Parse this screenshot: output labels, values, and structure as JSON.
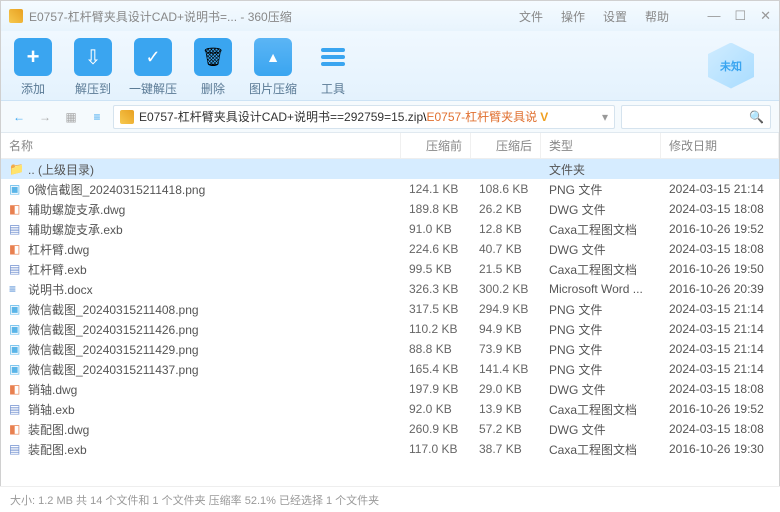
{
  "title": "E0757-杠杆臂夹具设计CAD+说明书=... - 360压缩",
  "menu": {
    "file": "文件",
    "op": "操作",
    "set": "设置",
    "help": "帮助"
  },
  "toolbar": {
    "add": "添加",
    "extract": "解压到",
    "oneclick": "一键解压",
    "delete": "删除",
    "imgcomp": "图片压缩",
    "tools": "工具",
    "badge": "未知"
  },
  "path": {
    "p1": "E0757-杠杆臂夹具设计CAD+说明书==292759=15.zip",
    "sep": "\\",
    "p2": "E0757-杠杆臂夹具说"
  },
  "cols": {
    "name": "名称",
    "before": "压缩前",
    "after": "压缩后",
    "type": "类型",
    "date": "修改日期"
  },
  "up": ".. (上级目录)",
  "uptype": "文件夹",
  "files": [
    {
      "ico": "fi-img",
      "name": "0微信截图_20240315211418.png",
      "bef": "124.1 KB",
      "aft": "108.6 KB",
      "type": "PNG 文件",
      "date": "2024-03-15 21:14"
    },
    {
      "ico": "fi-dwg",
      "name": "辅助螺旋支承.dwg",
      "bef": "189.8 KB",
      "aft": "26.2 KB",
      "type": "DWG 文件",
      "date": "2024-03-15 18:08"
    },
    {
      "ico": "fi-exb",
      "name": "辅助螺旋支承.exb",
      "bef": "91.0 KB",
      "aft": "12.8 KB",
      "type": "Caxa工程图文档",
      "date": "2016-10-26 19:52"
    },
    {
      "ico": "fi-dwg",
      "name": "杠杆臂.dwg",
      "bef": "224.6 KB",
      "aft": "40.7 KB",
      "type": "DWG 文件",
      "date": "2024-03-15 18:08"
    },
    {
      "ico": "fi-exb",
      "name": "杠杆臂.exb",
      "bef": "99.5 KB",
      "aft": "21.5 KB",
      "type": "Caxa工程图文档",
      "date": "2016-10-26 19:50"
    },
    {
      "ico": "fi-doc",
      "name": "说明书.docx",
      "bef": "326.3 KB",
      "aft": "300.2 KB",
      "type": "Microsoft Word ...",
      "date": "2016-10-26 20:39"
    },
    {
      "ico": "fi-img",
      "name": "微信截图_20240315211408.png",
      "bef": "317.5 KB",
      "aft": "294.9 KB",
      "type": "PNG 文件",
      "date": "2024-03-15 21:14"
    },
    {
      "ico": "fi-img",
      "name": "微信截图_20240315211426.png",
      "bef": "110.2 KB",
      "aft": "94.9 KB",
      "type": "PNG 文件",
      "date": "2024-03-15 21:14"
    },
    {
      "ico": "fi-img",
      "name": "微信截图_20240315211429.png",
      "bef": "88.8 KB",
      "aft": "73.9 KB",
      "type": "PNG 文件",
      "date": "2024-03-15 21:14"
    },
    {
      "ico": "fi-img",
      "name": "微信截图_20240315211437.png",
      "bef": "165.4 KB",
      "aft": "141.4 KB",
      "type": "PNG 文件",
      "date": "2024-03-15 21:14"
    },
    {
      "ico": "fi-dwg",
      "name": "销轴.dwg",
      "bef": "197.9 KB",
      "aft": "29.0 KB",
      "type": "DWG 文件",
      "date": "2024-03-15 18:08"
    },
    {
      "ico": "fi-exb",
      "name": "销轴.exb",
      "bef": "92.0 KB",
      "aft": "13.9 KB",
      "type": "Caxa工程图文档",
      "date": "2016-10-26 19:52"
    },
    {
      "ico": "fi-dwg",
      "name": "装配图.dwg",
      "bef": "260.9 KB",
      "aft": "57.2 KB",
      "type": "DWG 文件",
      "date": "2024-03-15 18:08"
    },
    {
      "ico": "fi-exb",
      "name": "装配图.exb",
      "bef": "117.0 KB",
      "aft": "38.7 KB",
      "type": "Caxa工程图文档",
      "date": "2016-10-26 19:30"
    }
  ],
  "status": "大小: 1.2 MB 共 14 个文件和 1 个文件夹 压缩率 52.1%  已经选择 1 个文件夹"
}
